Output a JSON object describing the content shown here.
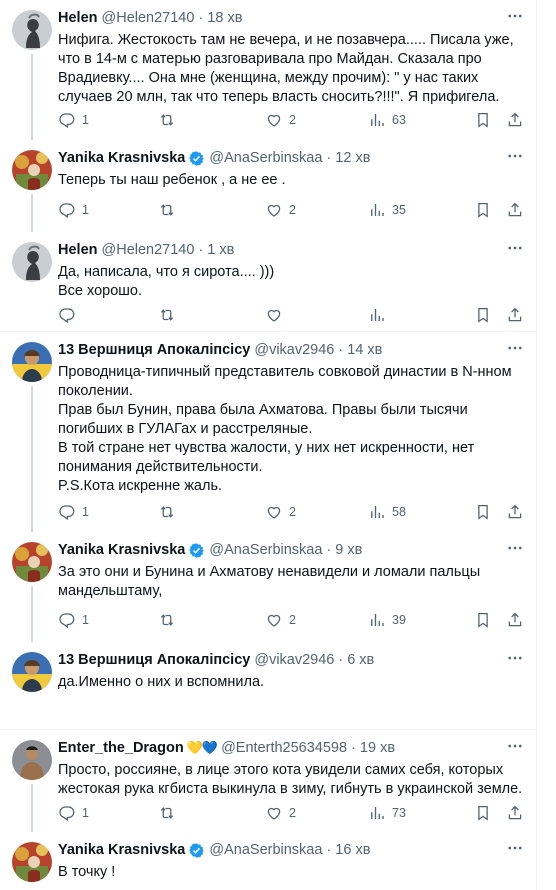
{
  "colors": {
    "text": "#0f1419",
    "muted": "#536471",
    "divider": "#eff3f4",
    "verified": "#1d9bf0",
    "thread_line": "#cfd9de"
  },
  "icons": [
    "more-icon",
    "reply-icon",
    "retweet-icon",
    "like-icon",
    "views-icon",
    "bookmark-icon",
    "share-icon",
    "verified-badge-icon"
  ],
  "tweets": [
    {
      "name": "Helen",
      "handle": "@Helen27140",
      "time": "18 хв",
      "text": "Нифига. Жестокость там не вечера, и не позавчера..... Писала уже, что в 14-м с матерью разговаривала про Майдан. Сказала про Врадиевку.... Она мне (женщина, между прочим): \" у нас таких случаев 20 млн, так что теперь власть сносить?!!!\". Я прифигела.",
      "replies": "1",
      "retweets": "",
      "likes": "2",
      "views": "63"
    },
    {
      "name": "Yanika Krasnivska",
      "handle": "@AnaSerbinskaa",
      "time": "12 хв",
      "text": "Теперь ты наш ребенок , а не ее .",
      "replies": "1",
      "retweets": "",
      "likes": "2",
      "views": "35"
    },
    {
      "name": "Helen",
      "handle": "@Helen27140",
      "time": "1 хв",
      "text": "Да,  написала, что я сирота.... )))\nВсе хорошо.",
      "replies": "",
      "retweets": "",
      "likes": "",
      "views": ""
    },
    {
      "name": "13 Вершниця Апокаліпсісу",
      "handle": "@vikav2946",
      "time": "14 хв",
      "text": "Проводница-типичный представитель совковой династии в N-нном поколении.\nПрав был Бунин, права была Ахматова. Правы были тысячи погибших в ГУЛАГах и расстреляные.\nВ той стране нет чувства жалости, у них нет искренности, нет понимания действительности.\nP.S.Кота искренне жаль.",
      "replies": "1",
      "retweets": "",
      "likes": "2",
      "views": "58"
    },
    {
      "name": "Yanika Krasnivska",
      "handle": "@AnaSerbinskaa",
      "time": "9 хв",
      "text": "За это они и Бунина и Ахматову ненавидели и ломали пальцы мандельштаму,",
      "replies": "1",
      "retweets": "",
      "likes": "2",
      "views": "39"
    },
    {
      "name": "13 Вершниця Апокаліпсісу",
      "handle": "@vikav2946",
      "time": "6 хв",
      "text": "да.Именно о них и вспомнила.",
      "replies": "",
      "retweets": "",
      "likes": "",
      "views": ""
    },
    {
      "name": "Enter_the_Dragon",
      "emoji": "💛💙",
      "handle": "@Enterth25634598",
      "time": "19 хв",
      "text": "Просто, россияне, в лице этого кота увидели самих себя, которых жестокая рука кгбиста выкинула в зиму, гибнуть в украинской земле.",
      "replies": "1",
      "retweets": "",
      "likes": "2",
      "views": "73"
    },
    {
      "name": "Yanika Krasnivska",
      "handle": "@AnaSerbinskaa",
      "time": "16 хв",
      "text": "В точку !",
      "replies": "",
      "retweets": "",
      "likes": "",
      "views": ""
    }
  ]
}
